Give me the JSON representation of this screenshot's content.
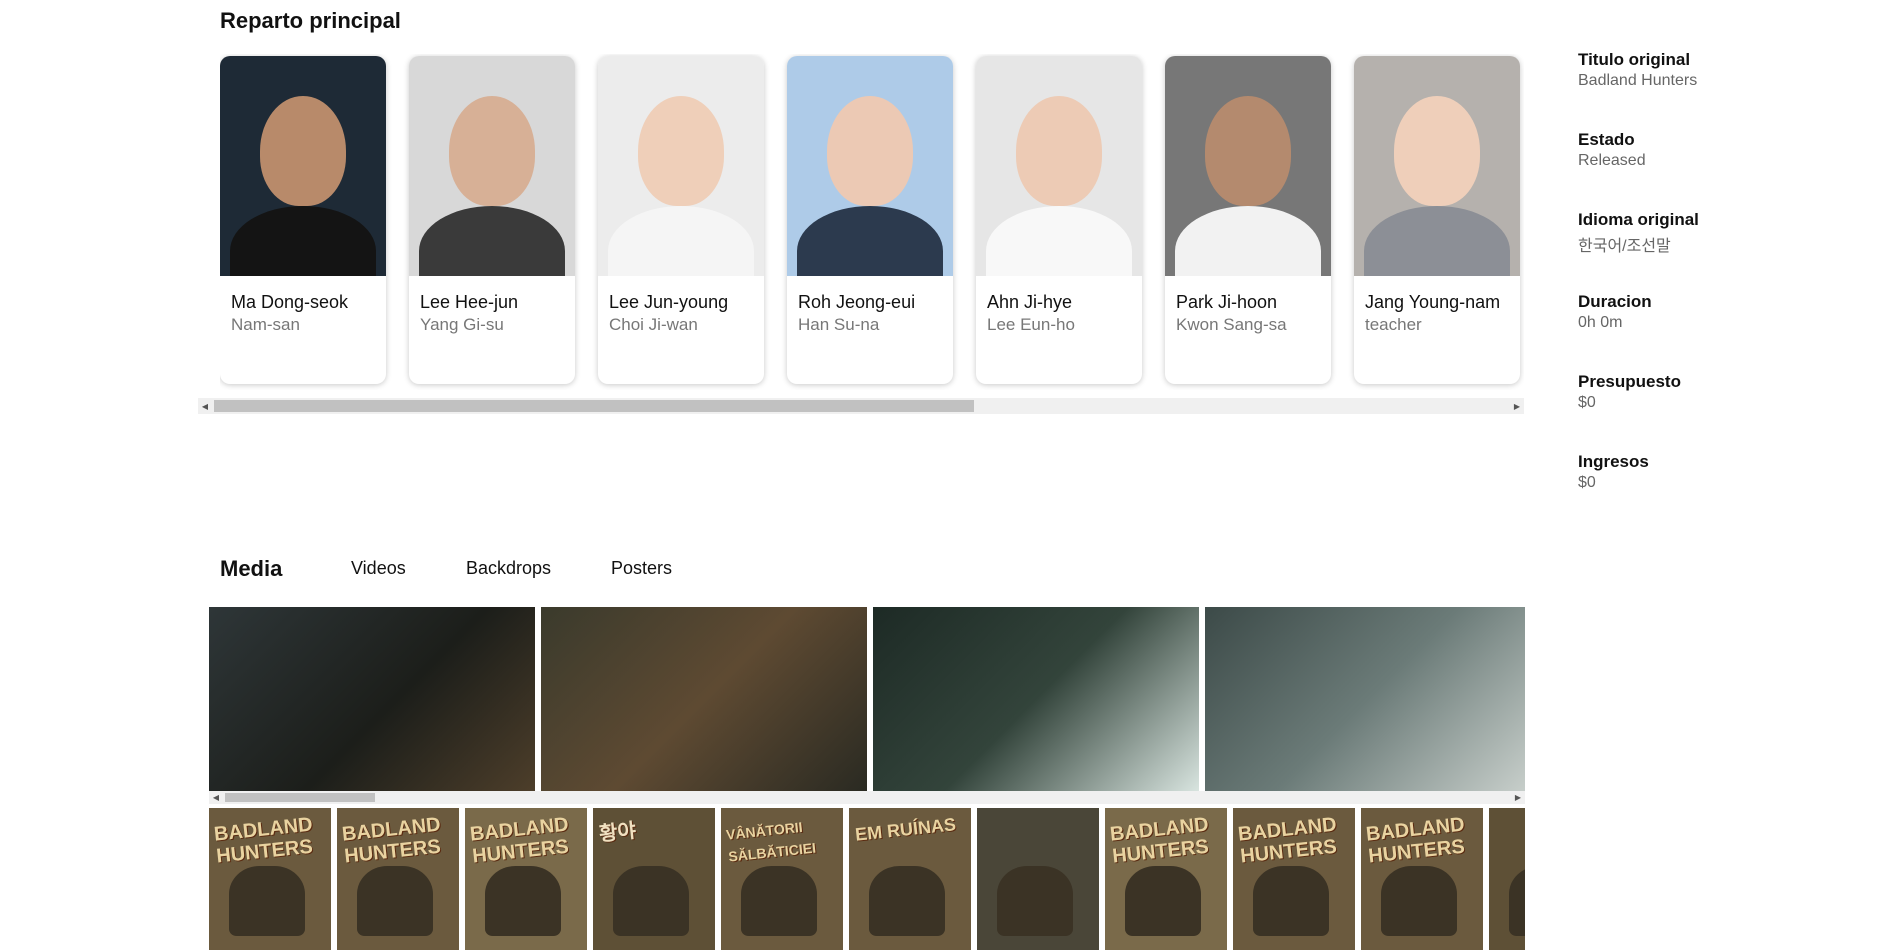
{
  "cast": {
    "title": "Reparto principal",
    "members": [
      {
        "name": "Ma Dong-seok",
        "role": "Nam-san"
      },
      {
        "name": "Lee Hee-jun",
        "role": "Yang Gi-su"
      },
      {
        "name": "Lee Jun-young",
        "role": "Choi Ji-wan"
      },
      {
        "name": "Roh Jeong-eui",
        "role": "Han Su-na"
      },
      {
        "name": "Ahn Ji-hye",
        "role": "Lee Eun-ho"
      },
      {
        "name": "Park Ji-hoon",
        "role": "Kwon Sang-sa"
      },
      {
        "name": "Jang Young-nam",
        "role": "teacher"
      }
    ]
  },
  "info": {
    "items": [
      {
        "label": "Titulo original",
        "value": "Badland Hunters"
      },
      {
        "label": "Estado",
        "value": "Released"
      },
      {
        "label": "Idioma original",
        "value": "한국어/조선말"
      },
      {
        "label": "Duracion",
        "value": "0h 0m"
      },
      {
        "label": "Presupuesto",
        "value": "$0"
      },
      {
        "label": "Ingresos",
        "value": "$0"
      }
    ]
  },
  "media": {
    "title": "Media",
    "tabs": [
      "Videos",
      "Backdrops",
      "Posters"
    ],
    "poster_titles": [
      "BADLAND\nHUNTERS",
      "BADLAND\nHUNTERS",
      "BADLAND\nHUNTERS",
      "황야",
      "VÂNĂTORII\nSĂLBĂTICIEI",
      "EM RUÍNAS",
      "",
      "BADLAND\nHUNTERS",
      "BADLAND\nHUNTERS",
      "BADLAND\nHUNTERS",
      ""
    ]
  },
  "scrollbars": {
    "left_arrow": "◀",
    "right_arrow": "▶"
  }
}
